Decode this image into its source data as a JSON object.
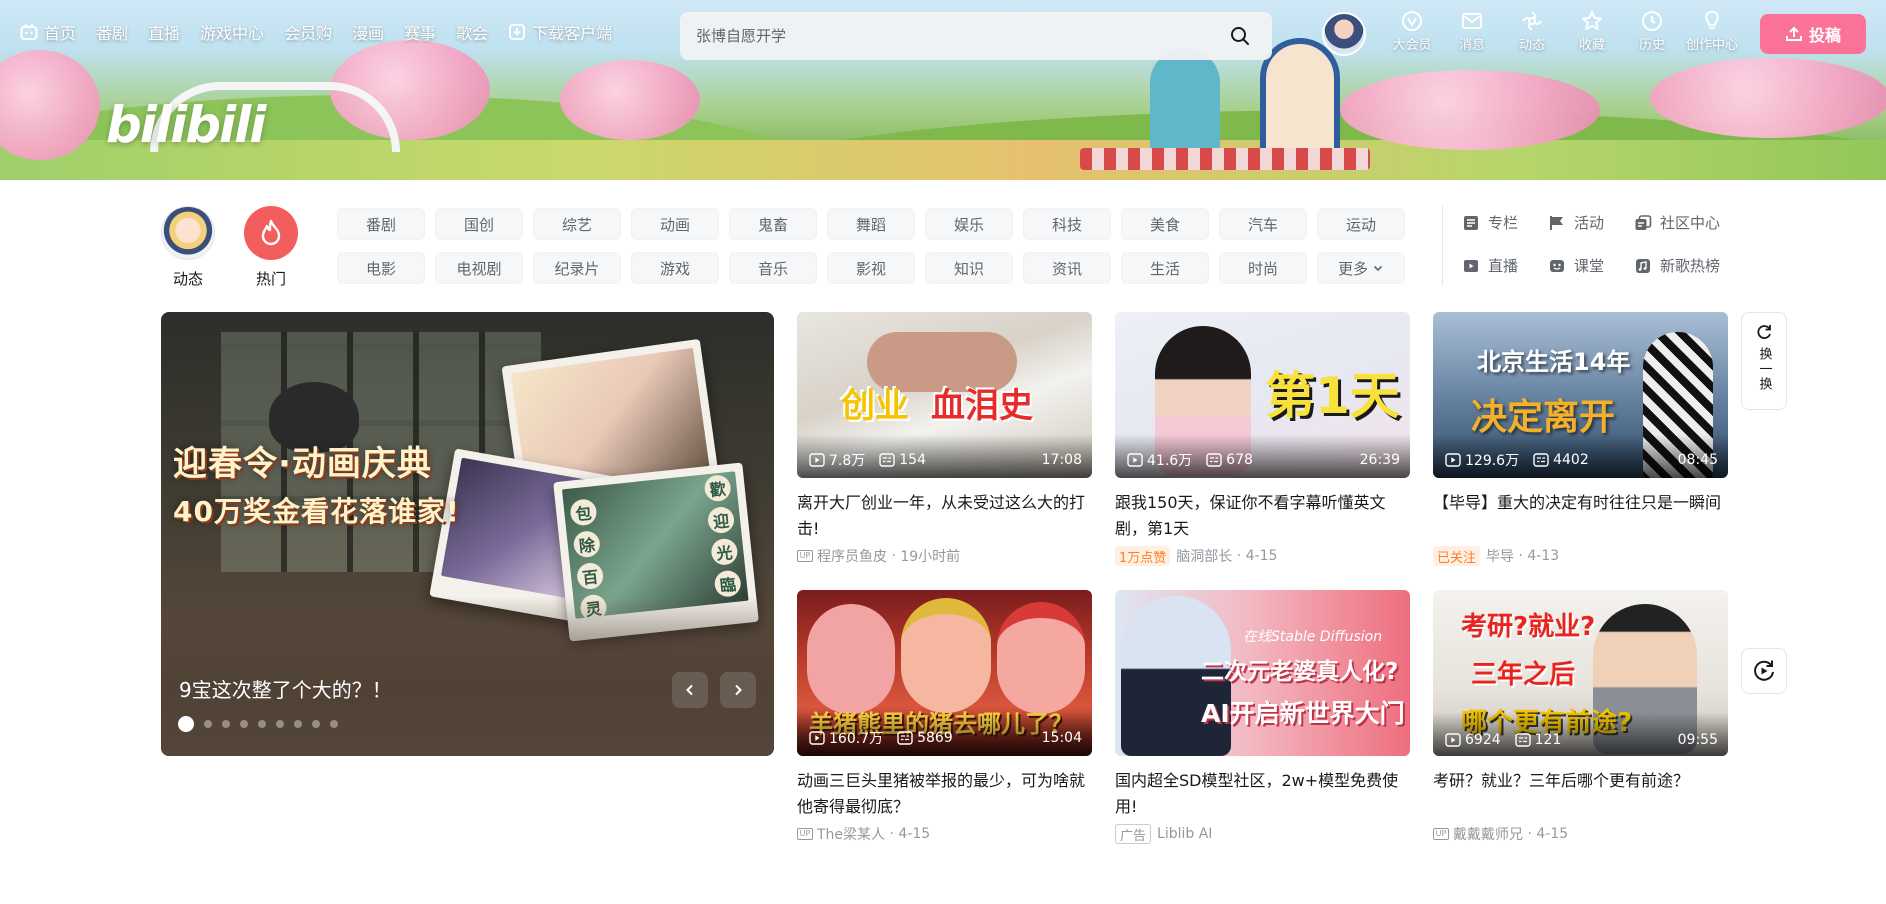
{
  "nav": {
    "items": [
      "首页",
      "番剧",
      "直播",
      "游戏中心",
      "会员购",
      "漫画",
      "赛事",
      "歌会",
      "下载客户端"
    ]
  },
  "search": {
    "placeholder": "张博自愿开学"
  },
  "right_nav": {
    "items": [
      {
        "label": "大会员",
        "icon": "vip-icon"
      },
      {
        "label": "消息",
        "icon": "message-icon"
      },
      {
        "label": "动态",
        "icon": "dynamic-icon"
      },
      {
        "label": "收藏",
        "icon": "favorite-icon"
      },
      {
        "label": "历史",
        "icon": "history-icon"
      },
      {
        "label": "创作中心",
        "icon": "creator-icon"
      }
    ],
    "upload_label": "投稿"
  },
  "logo_text": "bilibili",
  "big_channels": {
    "dynamic": "动态",
    "hot": "热门"
  },
  "channels": [
    "番剧",
    "国创",
    "综艺",
    "动画",
    "鬼畜",
    "舞蹈",
    "娱乐",
    "科技",
    "美食",
    "汽车",
    "运动",
    "电影",
    "电视剧",
    "纪录片",
    "游戏",
    "音乐",
    "影视",
    "知识",
    "资讯",
    "生活",
    "时尚",
    "更多"
  ],
  "side_links": [
    {
      "label": "专栏",
      "icon": "column-icon"
    },
    {
      "label": "活动",
      "icon": "flag-icon"
    },
    {
      "label": "社区中心",
      "icon": "community-icon"
    },
    {
      "label": "直播",
      "icon": "live-icon"
    },
    {
      "label": "课堂",
      "icon": "classroom-icon"
    },
    {
      "label": "新歌热榜",
      "icon": "music-chart-icon"
    }
  ],
  "carousel": {
    "headline_line1": "迎春令·动画庆典",
    "headline_line2": "40万奖金看花落谁家!",
    "title": "9宝这次整了个大的？！",
    "dot_count": 9,
    "active_dot": 0,
    "poster_words": [
      "包",
      "除",
      "百",
      "灵",
      "歡",
      "迎",
      "光",
      "臨"
    ]
  },
  "videos": [
    {
      "views": "7.8万",
      "danmaku": "154",
      "duration": "17:08",
      "title": "离开大厂创业一年，从未受过这么大的打击!",
      "author": "程序员鱼皮",
      "date": "19小时前",
      "badge": "",
      "thumb_text": [
        "创业",
        "血泪史"
      ]
    },
    {
      "views": "41.6万",
      "danmaku": "678",
      "duration": "26:39",
      "title": "跟我150天，保证你不看字幕听懂英文剧，第1天",
      "author": "脑洞部长",
      "date": "4-15",
      "badge": "1万点赞",
      "thumb_text": [
        "第1天"
      ]
    },
    {
      "views": "129.6万",
      "danmaku": "4402",
      "duration": "08:45",
      "title": "【毕导】重大的决定有时往往只是一瞬间",
      "author": "毕导",
      "date": "4-13",
      "badge": "已关注",
      "thumb_text": [
        "北京生活14年",
        "决定离开"
      ]
    },
    {
      "views": "160.7万",
      "danmaku": "5869",
      "duration": "15:04",
      "title": "动画三巨头里猪被举报的最少，可为啥就他寄得最彻底？",
      "author": "The梁某人",
      "date": "4-15",
      "badge": "",
      "thumb_text": [
        "羊猪熊里的猪去哪儿了？"
      ]
    },
    {
      "views": "",
      "danmaku": "",
      "duration": "",
      "title": "国内超全SD模型社区，2w+模型免费使用!",
      "author": "Liblib AI",
      "date": "",
      "badge": "广告",
      "thumb_text": [
        "在线Stable Diffusion",
        "二次元老婆真人化?",
        "AI开启新世界大门"
      ]
    },
    {
      "views": "6924",
      "danmaku": "121",
      "duration": "09:55",
      "title": "考研？就业？三年后哪个更有前途？",
      "author": "戴戴戴师兄",
      "date": "4-15",
      "badge": "",
      "thumb_text": [
        "考研?就业?",
        "三年之后",
        "哪个更有前途?"
      ]
    }
  ],
  "refresh": {
    "label": "换一换"
  },
  "colors": {
    "accent": "#fb7299",
    "text": "#18191c",
    "muted": "#9499a0",
    "orange": "#ff7f24"
  }
}
